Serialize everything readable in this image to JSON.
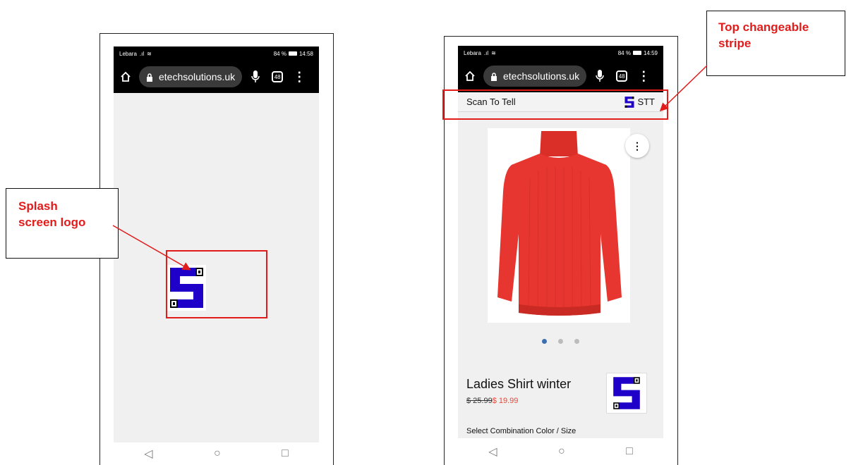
{
  "left_phone": {
    "status": {
      "carrier": "Lebara",
      "battery": "84 %",
      "time": "14:58"
    },
    "url": "etechsolutions.uk",
    "tab_count": "48"
  },
  "right_phone": {
    "status": {
      "carrier": "Lebara",
      "battery": "84 %",
      "time": "14:59"
    },
    "url": "etechsolutions.uk",
    "tab_count": "48",
    "stripe": {
      "title": "Scan To Tell",
      "brand": "STT"
    },
    "carousel": {
      "count": 3,
      "active_index": 0
    },
    "product": {
      "title": "Ladies Shirt winter",
      "old_price": "$ 25.99",
      "new_price": "$ 19.99",
      "options_label": "Select Combination Color / Size"
    }
  },
  "annotations": {
    "splash": {
      "line1": "Splash",
      "line2": "screen logo"
    },
    "stripe": {
      "line1": "Top changeable",
      "line2": "stripe"
    }
  },
  "colors": {
    "logo_blue": "#1e00c8",
    "annotation_red": "#e21b1b",
    "sweater_red": "#e6362f",
    "price_red": "#e04a3a"
  },
  "nav": {
    "back": "◁",
    "home": "○",
    "recents": "□"
  }
}
